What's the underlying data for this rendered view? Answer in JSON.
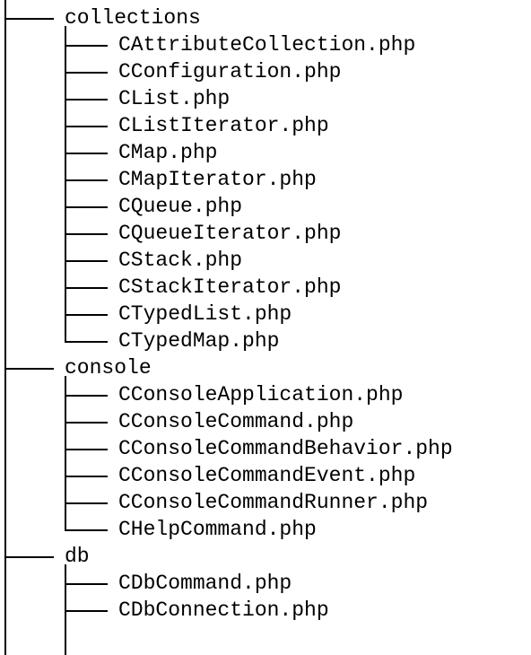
{
  "tree": {
    "folders": [
      {
        "name": "collections",
        "files": [
          "CAttributeCollection.php",
          "CConfiguration.php",
          "CList.php",
          "CListIterator.php",
          "CMap.php",
          "CMapIterator.php",
          "CQueue.php",
          "CQueueIterator.php",
          "CStack.php",
          "CStackIterator.php",
          "CTypedList.php",
          "CTypedMap.php"
        ],
        "files_complete": true
      },
      {
        "name": "console",
        "files": [
          "CConsoleApplication.php",
          "CConsoleCommand.php",
          "CConsoleCommandBehavior.php",
          "CConsoleCommandEvent.php",
          "CConsoleCommandRunner.php",
          "CHelpCommand.php"
        ],
        "files_complete": true
      },
      {
        "name": "db",
        "files": [
          "CDbCommand.php",
          "CDbConnection.php"
        ],
        "files_complete": false
      }
    ]
  }
}
